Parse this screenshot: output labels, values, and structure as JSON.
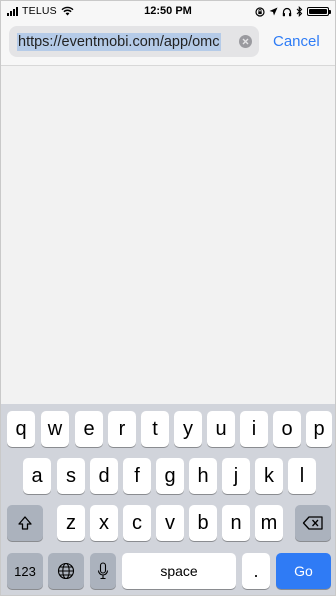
{
  "status_bar": {
    "carrier": "TELUS",
    "time": "12:50 PM"
  },
  "url_bar": {
    "url": "https://eventmobi.com/app/omc",
    "cancel_label": "Cancel"
  },
  "keyboard": {
    "row1": [
      "q",
      "w",
      "e",
      "r",
      "t",
      "y",
      "u",
      "i",
      "o",
      "p"
    ],
    "row2": [
      "a",
      "s",
      "d",
      "f",
      "g",
      "h",
      "j",
      "k",
      "l"
    ],
    "row3": [
      "z",
      "x",
      "c",
      "v",
      "b",
      "n",
      "m"
    ],
    "numbers_label": "123",
    "space_label": "space",
    "period_label": ".",
    "go_label": "Go"
  },
  "colors": {
    "accent": "#2e7cf6",
    "go_key": "#2f7bf5",
    "keyboard_bg": "#d1d4db",
    "selection": "#b5cbe8"
  }
}
